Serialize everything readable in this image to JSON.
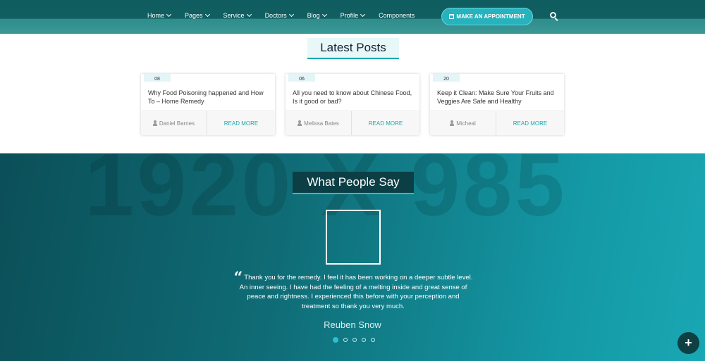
{
  "nav": {
    "items": [
      {
        "label": "Home",
        "has_dropdown": true
      },
      {
        "label": "Pages",
        "has_dropdown": true
      },
      {
        "label": "Service",
        "has_dropdown": true
      },
      {
        "label": "Doctors",
        "has_dropdown": true
      },
      {
        "label": "Blog",
        "has_dropdown": true
      },
      {
        "label": "Profile",
        "has_dropdown": true
      },
      {
        "label": "Components",
        "has_dropdown": false
      }
    ],
    "appointment_label": "MAKE AN APPOINTMENT",
    "search_icon": "search-icon"
  },
  "latest_posts": {
    "title": "Latest Posts",
    "posts": [
      {
        "date": "08",
        "title": "Why Food Poisoning happened and How To – Home Remedy",
        "author": "Daniel Barnes",
        "read_more": "READ MORE"
      },
      {
        "date": "06",
        "title": "All you need to know about Chinese Food, Is it good or bad?",
        "author": "Melissa Bates",
        "read_more": "READ MORE"
      },
      {
        "date": "20",
        "title": "Keep it Clean: Make Sure Your Fruits and Veggies Are Safe and Healthy",
        "author": "Micheal",
        "read_more": "READ MORE"
      }
    ]
  },
  "testimonials": {
    "background_text": "1920 X 985",
    "title": "What People Say",
    "quote": "Thank you for the remedy. I feel it has been working on a deeper subtle level. An inner seeing. I have had the feeling of a melting inside and great sense of peace and rightness. I experienced this before with your perception and treatment so thank you very much.",
    "author": "Reuben Snow",
    "slide_count": 5,
    "active_slide": 1
  },
  "fab_label": "+",
  "colors": {
    "primary": "#1aa9b2",
    "dark_teal": "#0f5d60",
    "fab": "#0d3f43"
  }
}
